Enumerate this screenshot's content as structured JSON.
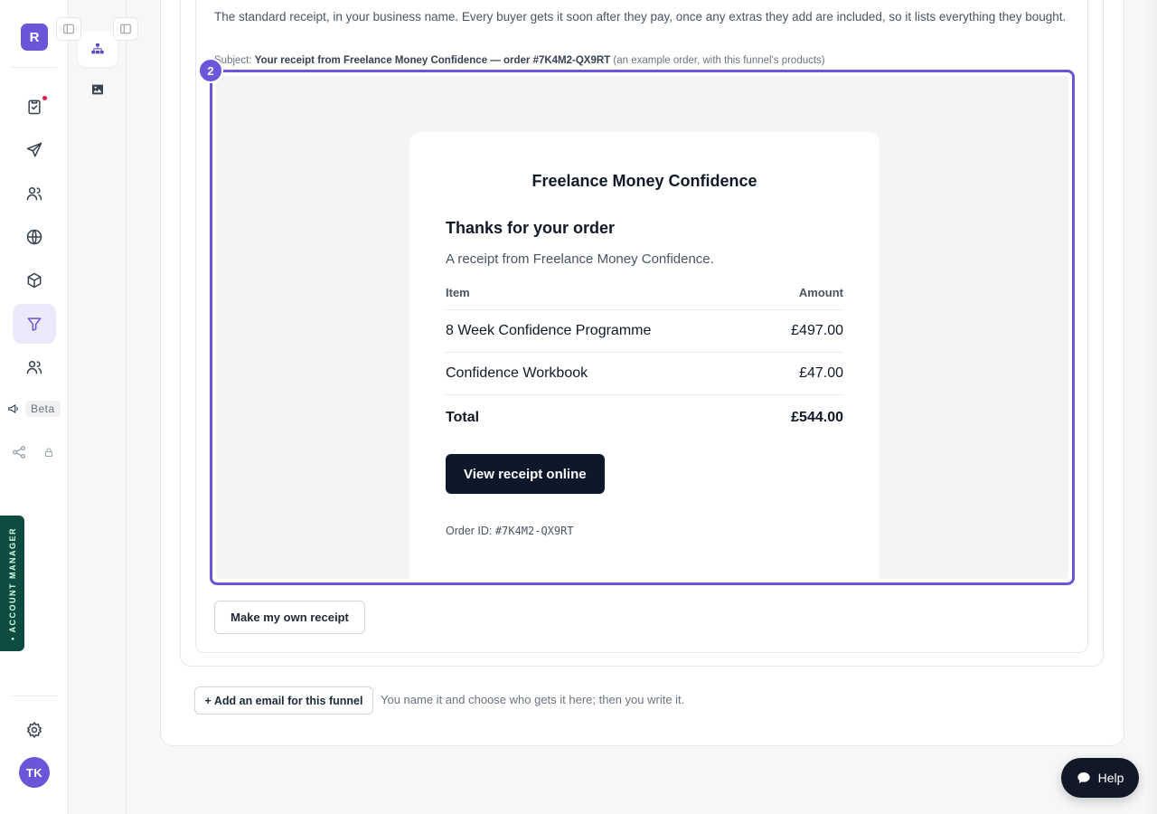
{
  "app": {
    "workspace_initial": "R",
    "user_initials": "TK",
    "beta_label": "Beta",
    "account_manager_label": "• ACCOUNT MANAGER",
    "accent_color": "#6d55d9"
  },
  "rail": {
    "icons": [
      "checklist-icon",
      "send-icon",
      "audience-icon",
      "globe-icon",
      "product-box-icon",
      "funnel-icon",
      "users-icon",
      "megaphone-icon",
      "share-icon",
      "lock-icon",
      "settings-icon"
    ]
  },
  "receipt_section": {
    "description": "The standard receipt, in your business name. Every buyer gets it soon after they pay, once any extras they add are included, so it lists everything they bought.",
    "subject_prefix": "Subject:",
    "subject_value": "Your receipt from Freelance Money Confidence — order #7K4M2-QX9RT",
    "subject_note": "(an example order, with this funnel's products)",
    "step_number": "2",
    "make_own_button": "Make my own receipt"
  },
  "email_preview": {
    "brand": "Freelance Money Confidence",
    "heading": "Thanks for your order",
    "subheading": "A receipt from Freelance Money Confidence.",
    "table": {
      "headers": [
        "Item",
        "Amount"
      ],
      "rows": [
        {
          "item": "8 Week Confidence Programme",
          "amount": "£497.00"
        },
        {
          "item": "Confidence Workbook",
          "amount": "£47.00"
        }
      ],
      "total_label": "Total",
      "total_amount": "£544.00"
    },
    "button_label": "View receipt online",
    "order_id_label": "Order ID:",
    "order_id_value": "#7K4M2-QX9RT"
  },
  "footer_actions": {
    "add_email_button": "+ Add an email for this funnel",
    "add_email_hint": "You name it and choose who gets it here; then you write it."
  },
  "help": {
    "label": "Help"
  }
}
